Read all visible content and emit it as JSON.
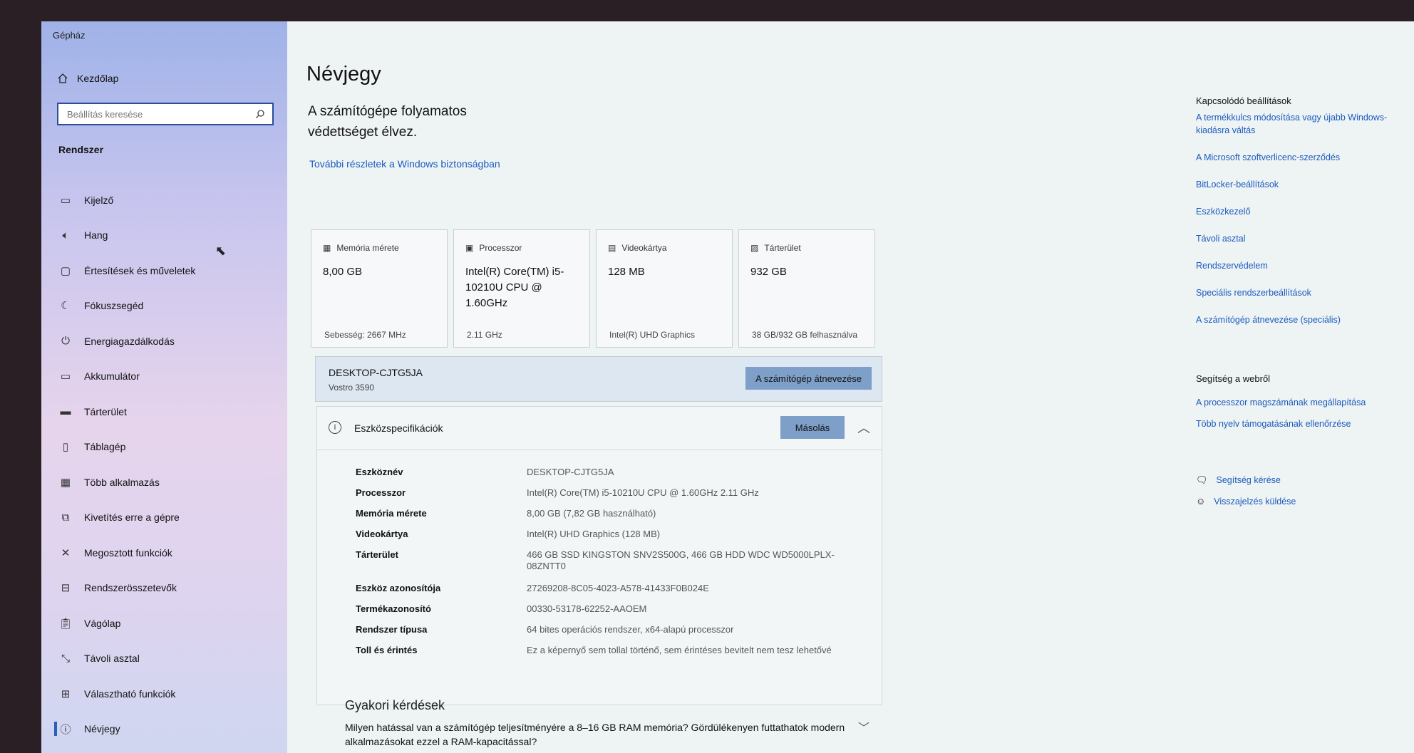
{
  "sidebar": {
    "app_title": "Gépház",
    "home_label": "Kezdőlap",
    "search_placeholder": "Beállítás keresése",
    "section_label": "Rendszer",
    "items": [
      {
        "label": "Kijelző",
        "icon": "monitor-icon"
      },
      {
        "label": "Hang",
        "icon": "speaker-icon"
      },
      {
        "label": "Értesítések és műveletek",
        "icon": "notification-icon"
      },
      {
        "label": "Fókuszsegéd",
        "icon": "moon-icon"
      },
      {
        "label": "Energiagazdálkodás",
        "icon": "power-icon"
      },
      {
        "label": "Akkumulátor",
        "icon": "battery-icon"
      },
      {
        "label": "Tárterület",
        "icon": "storage-icon"
      },
      {
        "label": "Táblagép",
        "icon": "tablet-icon"
      },
      {
        "label": "Több alkalmazás",
        "icon": "multitasking-icon"
      },
      {
        "label": "Kivetítés erre a gépre",
        "icon": "projecting-icon"
      },
      {
        "label": "Megosztott funkciók",
        "icon": "shared-icon"
      },
      {
        "label": "Rendszerösszetevők",
        "icon": "components-icon"
      },
      {
        "label": "Vágólap",
        "icon": "clipboard-icon"
      },
      {
        "label": "Távoli asztal",
        "icon": "remote-desktop-icon"
      },
      {
        "label": "Választható funkciók",
        "icon": "optional-features-icon"
      },
      {
        "label": "Névjegy",
        "icon": "info-icon"
      }
    ]
  },
  "main": {
    "title": "Névjegy",
    "subtitle": "A számítógépe folyamatos védettséget élvez.",
    "security_link": "További részletek a Windows biztonságban",
    "cards": [
      {
        "head": "Memória mérete",
        "value": "8,00 GB",
        "foot": "Sebesség: 2667 MHz",
        "icon": "memory-icon"
      },
      {
        "head": "Processzor",
        "value": "Intel(R) Core(TM) i5-10210U CPU @ 1.60GHz",
        "foot": "2.11 GHz",
        "icon": "cpu-icon"
      },
      {
        "head": "Videokártya",
        "value": "128 MB",
        "foot": "Intel(R) UHD Graphics",
        "icon": "gpu-icon"
      },
      {
        "head": "Tárterület",
        "value": "932 GB",
        "foot": "38 GB/932 GB felhasználva",
        "icon": "disk-icon"
      }
    ],
    "pc_name": "DESKTOP-CJTG5JA",
    "pc_model": "Vostro 3590",
    "rename_button": "A számítógép átnevezése",
    "specs_title": "Eszközspecifikációk",
    "copy_button": "Másolás",
    "specs": [
      {
        "k": "Eszköznév",
        "v": "DESKTOP-CJTG5JA"
      },
      {
        "k": "Processzor",
        "v": "Intel(R) Core(TM) i5-10210U CPU @ 1.60GHz   2.11 GHz"
      },
      {
        "k": "Memória mérete",
        "v": "8,00 GB (7,82 GB használható)"
      },
      {
        "k": "Videokártya",
        "v": "Intel(R) UHD Graphics (128 MB)"
      },
      {
        "k": "Tárterület",
        "v": "466 GB SSD KINGSTON SNV2S500G, 466 GB HDD WDC WD5000LPLX-08ZNTT0"
      },
      {
        "k": "Eszköz azonosítója",
        "v": "27269208-8C05-4023-A578-41433F0B024E"
      },
      {
        "k": "Termékazonosító",
        "v": "00330-53178-62252-AAOEM"
      },
      {
        "k": "Rendszer típusa",
        "v": "64 bites operációs rendszer, x64-alapú processzor"
      },
      {
        "k": "Toll és érintés",
        "v": "Ez a képernyő sem tollal történő, sem érintéses bevitelt nem tesz lehetővé"
      }
    ],
    "faq_title": "Gyakori kérdések",
    "faq_question": "Milyen hatással van a számítógép teljesítményére a 8–16 GB RAM memória? Gördülékenyen futtathatok modern alkalmazásokat ezzel a RAM-kapacitással?"
  },
  "right": {
    "related_title": "Kapcsolódó beállítások",
    "related_links": [
      "A termékkulcs módosítása vagy újabb Windows-kiadásra váltás",
      "A Microsoft szoftverlicenc-szerződés",
      "BitLocker-beállítások",
      "Eszközkezelő",
      "Távoli asztal",
      "Rendszervédelem",
      "Speciális rendszerbeállítások",
      "A számítógép átnevezése (speciális)"
    ],
    "help_title": "Segítség a webről",
    "help_links": [
      "A processzor magszámának megállapítása",
      "Több nyelv támogatásának ellenőrzése"
    ],
    "get_help": "Segítség kérése",
    "feedback": "Visszajelzés küldése"
  }
}
